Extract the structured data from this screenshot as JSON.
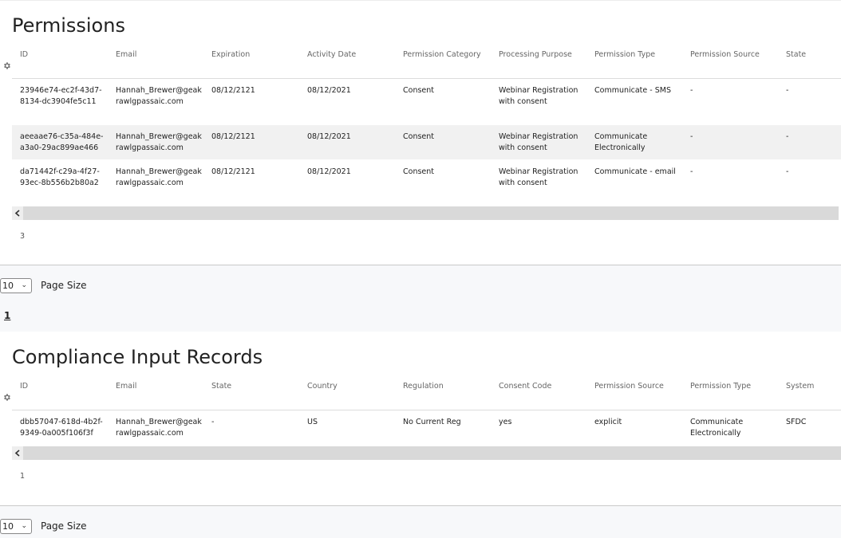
{
  "permissions": {
    "title": "Permissions",
    "columns": [
      "ID",
      "Email",
      "Expiration",
      "Activity Date",
      "Permission Category",
      "Processing Purpose",
      "Permission Type",
      "Permission Source",
      "State"
    ],
    "rows": [
      [
        "23946e74-ec2f-43d7-8134-dc3904fe5c11",
        "Hannah_Brewer@geakrawlgpassaic.com",
        "08/12/2121",
        "08/12/2021",
        "Consent",
        "Webinar Registration with consent",
        "Communicate - SMS",
        "-",
        "-"
      ],
      [
        "aeeaae76-c35a-484e-a3a0-29ac899ae466",
        "Hannah_Brewer@geakrawlgpassaic.com",
        "08/12/2121",
        "08/12/2021",
        "Consent",
        "Webinar Registration with consent",
        "Communicate Electronically",
        "-",
        "-"
      ],
      [
        "da71442f-c29a-4f27-93ec-8b556b2b80a2",
        "Hannah_Brewer@geakrawlgpassaic.com",
        "08/12/2121",
        "08/12/2021",
        "Consent",
        "Webinar Registration with consent",
        "Communicate - email",
        "-",
        "-"
      ]
    ],
    "count": "3",
    "page_size": "10",
    "page_size_label": "Page Size",
    "current_page": "1"
  },
  "compliance": {
    "title": "Compliance Input Records",
    "columns": [
      "ID",
      "Email",
      "State",
      "Country",
      "Regulation",
      "Consent Code",
      "Permission Source",
      "Permission Type",
      "System"
    ],
    "rows": [
      [
        "dbb57047-618d-4b2f-9349-0a005f106f3f",
        "Hannah_Brewer@geakrawlgpassaic.com",
        "-",
        "US",
        "No Current Reg",
        "yes",
        "explicit",
        "Communicate Electronically",
        "SFDC"
      ]
    ],
    "count": "1",
    "page_size": "10",
    "page_size_label": "Page Size"
  },
  "icons": {
    "settings": "gear-icon",
    "scroll_left": "chevron-left-icon",
    "select": "chevron-down-icon"
  }
}
